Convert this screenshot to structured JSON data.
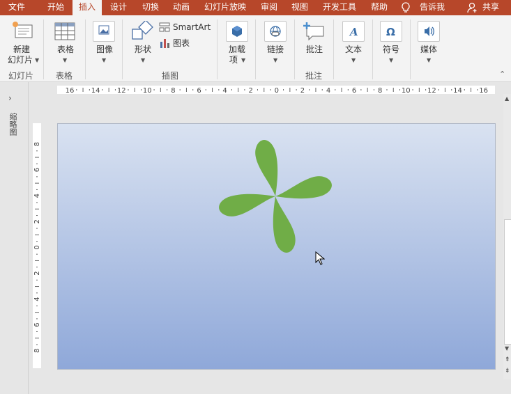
{
  "tabs": [
    "文件",
    "开始",
    "插入",
    "设计",
    "切换",
    "动画",
    "幻灯片放映",
    "审阅",
    "视图",
    "开发工具",
    "帮助"
  ],
  "active_tab": "插入",
  "tell_me": "告诉我",
  "share": "共享",
  "ribbon": {
    "new_slide": [
      "新建",
      "幻灯片"
    ],
    "table": "表格",
    "image": "图像",
    "shapes": "形状",
    "smartart": "SmartArt",
    "chart": "图表",
    "addins": [
      "加载",
      "项"
    ],
    "link": "链接",
    "comment": "批注",
    "text": "文本",
    "symbol": "符号",
    "media": "媒体"
  },
  "groups": [
    "幻灯片",
    "表格",
    "插图",
    "批注"
  ],
  "side_panel_label": "缩略图",
  "rulers": {
    "horizontal": [
      "16",
      "14",
      "12",
      "10",
      "8",
      "6",
      "4",
      "2",
      "0",
      "2",
      "4",
      "6",
      "8",
      "10",
      "12",
      "14",
      "16"
    ],
    "vertical": [
      "8",
      "6",
      "4",
      "2",
      "0",
      "2",
      "4",
      "6",
      "8"
    ]
  },
  "colors": {
    "accent": "#b7472a",
    "shape_fill": "#70ad47"
  }
}
